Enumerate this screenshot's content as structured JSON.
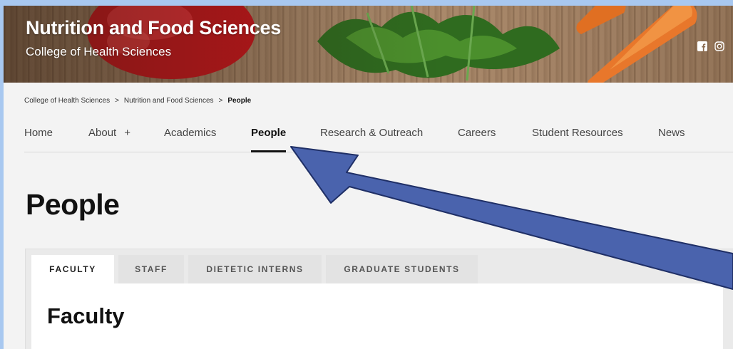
{
  "banner": {
    "title": "Nutrition and Food Sciences",
    "subtitle": "College of Health Sciences",
    "social": [
      "facebook-icon",
      "instagram-icon"
    ]
  },
  "breadcrumb": {
    "items": [
      "College of Health Sciences",
      "Nutrition and Food Sciences"
    ],
    "current": "People",
    "separator": ">"
  },
  "nav": {
    "items": [
      {
        "label": "Home"
      },
      {
        "label": "About",
        "suffix": "+"
      },
      {
        "label": "Academics"
      },
      {
        "label": "People",
        "active": true
      },
      {
        "label": "Research & Outreach"
      },
      {
        "label": "Careers"
      },
      {
        "label": "Student Resources"
      },
      {
        "label": "News"
      }
    ]
  },
  "page": {
    "title": "People"
  },
  "tabs": {
    "items": [
      {
        "label": "FACULTY",
        "active": true
      },
      {
        "label": "STAFF"
      },
      {
        "label": "DIETETIC INTERNS"
      },
      {
        "label": "GRADUATE STUDENTS"
      }
    ],
    "section_title": "Faculty"
  },
  "colors": {
    "arrow_fill": "#4a63ad",
    "arrow_stroke": "#1f2f66",
    "outer_background": "#a8c8f0"
  }
}
